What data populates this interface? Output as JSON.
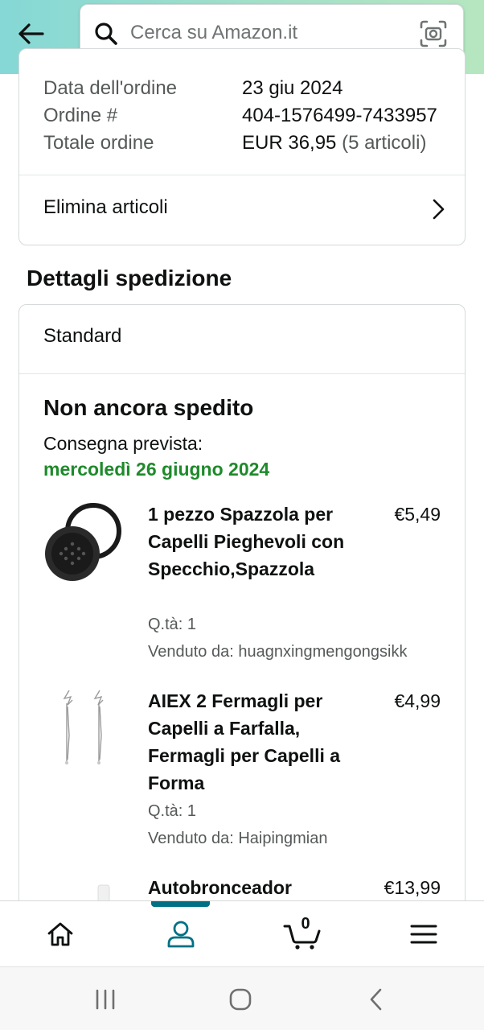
{
  "header": {
    "search_placeholder": "Cerca su Amazon.it"
  },
  "order_summary": {
    "rows": [
      {
        "label": "Data dell'ordine",
        "value": "23 giu 2024",
        "extra": ""
      },
      {
        "label": "Ordine #",
        "value": "404-1576499-7433957",
        "extra": ""
      },
      {
        "label": "Totale ordine",
        "value": "EUR 36,95",
        "extra": "(5 articoli)"
      }
    ],
    "remove_items_label": "Elimina articoli"
  },
  "shipment": {
    "section_title": "Dettagli spedizione",
    "method": "Standard",
    "status": "Non ancora spedito",
    "delivery_label": "Consegna prevista:",
    "delivery_date": "mercoledì 26 giugno 2024",
    "items": [
      {
        "title": "1 pezzo Spazzola per Capelli Pieghevoli con Specchio,Spazzola",
        "price": "€5,49",
        "qty": "Q.tà: 1",
        "seller": "Venduto da: huagnxingmengongsikk"
      },
      {
        "title": "AIEX 2 Fermagli per Capelli a Farfalla, Fermagli per Capelli a Forma",
        "price": "€4,99",
        "qty": "Q.tà: 1",
        "seller": "Venduto da: Haipingmian"
      },
      {
        "title": "Autobronceador",
        "price": "€13,99",
        "qty": "",
        "seller": ""
      }
    ]
  },
  "bottom_nav": {
    "cart_count": "0",
    "active": "account"
  },
  "colors": {
    "delivery_green": "#1e8a2a",
    "active_teal": "#007185"
  }
}
